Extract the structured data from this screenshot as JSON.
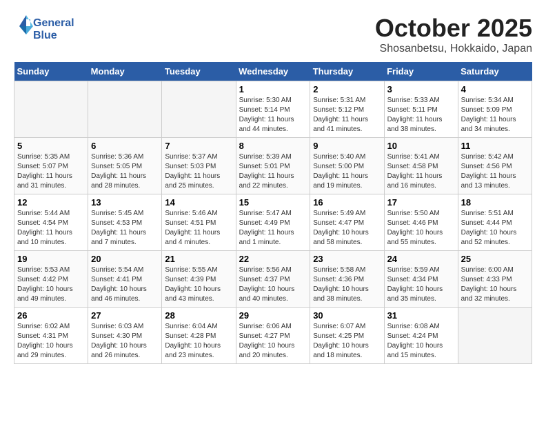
{
  "header": {
    "logo_line1": "General",
    "logo_line2": "Blue",
    "month_title": "October 2025",
    "location": "Shosanbetsu, Hokkaido, Japan"
  },
  "days_of_week": [
    "Sunday",
    "Monday",
    "Tuesday",
    "Wednesday",
    "Thursday",
    "Friday",
    "Saturday"
  ],
  "weeks": [
    [
      {
        "day": "",
        "info": ""
      },
      {
        "day": "",
        "info": ""
      },
      {
        "day": "",
        "info": ""
      },
      {
        "day": "1",
        "info": "Sunrise: 5:30 AM\nSunset: 5:14 PM\nDaylight: 11 hours\nand 44 minutes."
      },
      {
        "day": "2",
        "info": "Sunrise: 5:31 AM\nSunset: 5:12 PM\nDaylight: 11 hours\nand 41 minutes."
      },
      {
        "day": "3",
        "info": "Sunrise: 5:33 AM\nSunset: 5:11 PM\nDaylight: 11 hours\nand 38 minutes."
      },
      {
        "day": "4",
        "info": "Sunrise: 5:34 AM\nSunset: 5:09 PM\nDaylight: 11 hours\nand 34 minutes."
      }
    ],
    [
      {
        "day": "5",
        "info": "Sunrise: 5:35 AM\nSunset: 5:07 PM\nDaylight: 11 hours\nand 31 minutes."
      },
      {
        "day": "6",
        "info": "Sunrise: 5:36 AM\nSunset: 5:05 PM\nDaylight: 11 hours\nand 28 minutes."
      },
      {
        "day": "7",
        "info": "Sunrise: 5:37 AM\nSunset: 5:03 PM\nDaylight: 11 hours\nand 25 minutes."
      },
      {
        "day": "8",
        "info": "Sunrise: 5:39 AM\nSunset: 5:01 PM\nDaylight: 11 hours\nand 22 minutes."
      },
      {
        "day": "9",
        "info": "Sunrise: 5:40 AM\nSunset: 5:00 PM\nDaylight: 11 hours\nand 19 minutes."
      },
      {
        "day": "10",
        "info": "Sunrise: 5:41 AM\nSunset: 4:58 PM\nDaylight: 11 hours\nand 16 minutes."
      },
      {
        "day": "11",
        "info": "Sunrise: 5:42 AM\nSunset: 4:56 PM\nDaylight: 11 hours\nand 13 minutes."
      }
    ],
    [
      {
        "day": "12",
        "info": "Sunrise: 5:44 AM\nSunset: 4:54 PM\nDaylight: 11 hours\nand 10 minutes."
      },
      {
        "day": "13",
        "info": "Sunrise: 5:45 AM\nSunset: 4:53 PM\nDaylight: 11 hours\nand 7 minutes."
      },
      {
        "day": "14",
        "info": "Sunrise: 5:46 AM\nSunset: 4:51 PM\nDaylight: 11 hours\nand 4 minutes."
      },
      {
        "day": "15",
        "info": "Sunrise: 5:47 AM\nSunset: 4:49 PM\nDaylight: 11 hours\nand 1 minute."
      },
      {
        "day": "16",
        "info": "Sunrise: 5:49 AM\nSunset: 4:47 PM\nDaylight: 10 hours\nand 58 minutes."
      },
      {
        "day": "17",
        "info": "Sunrise: 5:50 AM\nSunset: 4:46 PM\nDaylight: 10 hours\nand 55 minutes."
      },
      {
        "day": "18",
        "info": "Sunrise: 5:51 AM\nSunset: 4:44 PM\nDaylight: 10 hours\nand 52 minutes."
      }
    ],
    [
      {
        "day": "19",
        "info": "Sunrise: 5:53 AM\nSunset: 4:42 PM\nDaylight: 10 hours\nand 49 minutes."
      },
      {
        "day": "20",
        "info": "Sunrise: 5:54 AM\nSunset: 4:41 PM\nDaylight: 10 hours\nand 46 minutes."
      },
      {
        "day": "21",
        "info": "Sunrise: 5:55 AM\nSunset: 4:39 PM\nDaylight: 10 hours\nand 43 minutes."
      },
      {
        "day": "22",
        "info": "Sunrise: 5:56 AM\nSunset: 4:37 PM\nDaylight: 10 hours\nand 40 minutes."
      },
      {
        "day": "23",
        "info": "Sunrise: 5:58 AM\nSunset: 4:36 PM\nDaylight: 10 hours\nand 38 minutes."
      },
      {
        "day": "24",
        "info": "Sunrise: 5:59 AM\nSunset: 4:34 PM\nDaylight: 10 hours\nand 35 minutes."
      },
      {
        "day": "25",
        "info": "Sunrise: 6:00 AM\nSunset: 4:33 PM\nDaylight: 10 hours\nand 32 minutes."
      }
    ],
    [
      {
        "day": "26",
        "info": "Sunrise: 6:02 AM\nSunset: 4:31 PM\nDaylight: 10 hours\nand 29 minutes."
      },
      {
        "day": "27",
        "info": "Sunrise: 6:03 AM\nSunset: 4:30 PM\nDaylight: 10 hours\nand 26 minutes."
      },
      {
        "day": "28",
        "info": "Sunrise: 6:04 AM\nSunset: 4:28 PM\nDaylight: 10 hours\nand 23 minutes."
      },
      {
        "day": "29",
        "info": "Sunrise: 6:06 AM\nSunset: 4:27 PM\nDaylight: 10 hours\nand 20 minutes."
      },
      {
        "day": "30",
        "info": "Sunrise: 6:07 AM\nSunset: 4:25 PM\nDaylight: 10 hours\nand 18 minutes."
      },
      {
        "day": "31",
        "info": "Sunrise: 6:08 AM\nSunset: 4:24 PM\nDaylight: 10 hours\nand 15 minutes."
      },
      {
        "day": "",
        "info": ""
      }
    ]
  ]
}
